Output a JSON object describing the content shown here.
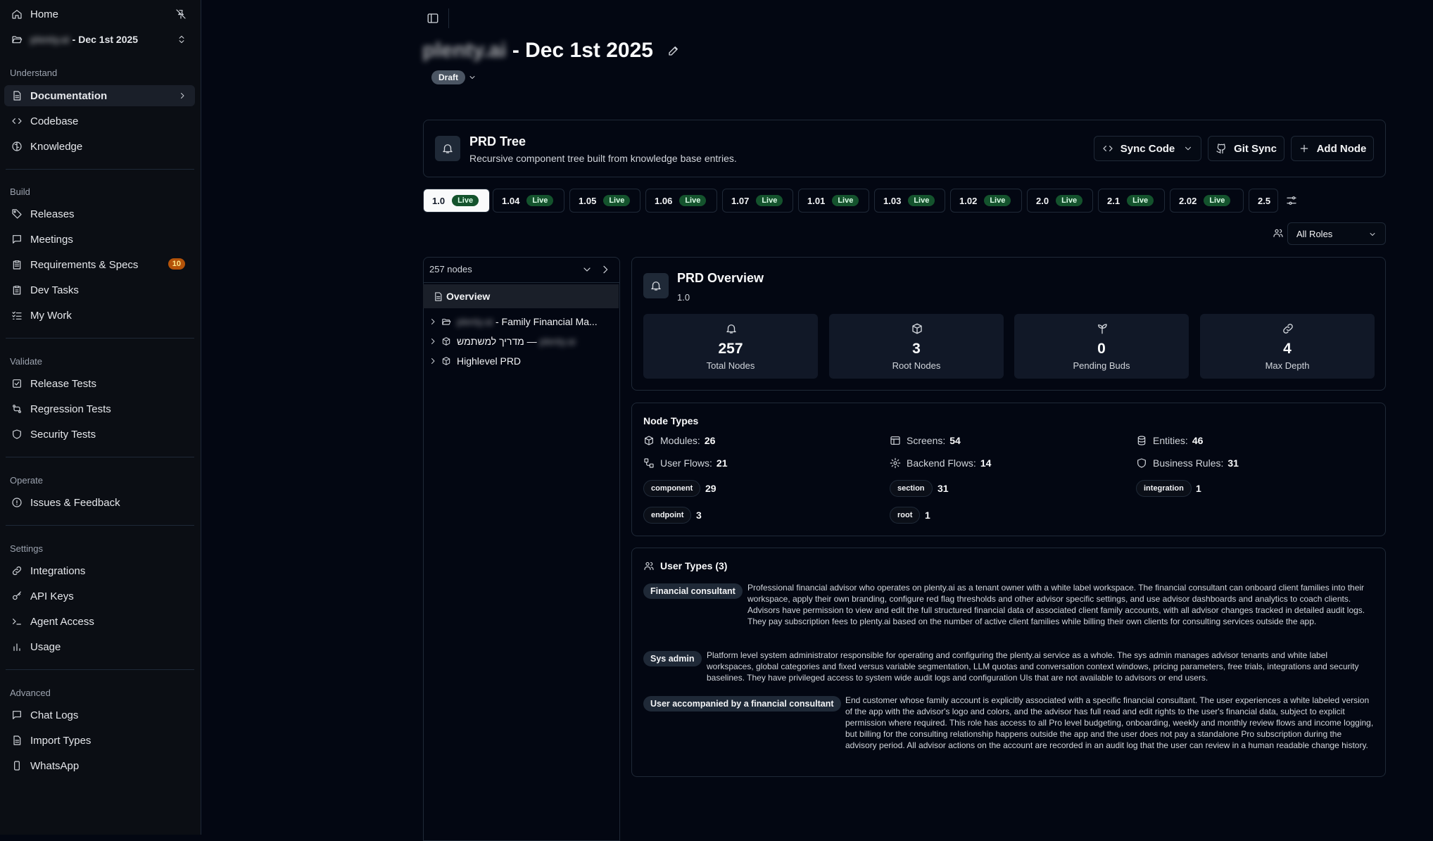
{
  "sidebar": {
    "home": "Home",
    "project": {
      "name": "plenty.ai",
      "date": " - Dec 1st 2025"
    },
    "sections": {
      "understand": "Understand",
      "build": "Build",
      "validate": "Validate",
      "operate": "Operate",
      "settings": "Settings",
      "advanced": "Advanced"
    },
    "items": {
      "documentation": "Documentation",
      "codebase": "Codebase",
      "knowledge": "Knowledge",
      "releases": "Releases",
      "meetings": "Meetings",
      "requirements": "Requirements & Specs",
      "requirements_count": "10",
      "dev_tasks": "Dev Tasks",
      "my_work": "My Work",
      "release_tests": "Release Tests",
      "regression_tests": "Regression Tests",
      "security_tests": "Security Tests",
      "issues": "Issues & Feedback",
      "integrations": "Integrations",
      "api_keys": "API Keys",
      "agent_access": "Agent Access",
      "usage": "Usage",
      "chat_logs": "Chat Logs",
      "import_types": "Import Types",
      "whatsapp": "WhatsApp"
    }
  },
  "header": {
    "title_blurred": "plenty.ai",
    "title": " - Dec 1st 2025",
    "status": "Draft"
  },
  "prd_tree": {
    "title": "PRD Tree",
    "subtitle": "Recursive component tree built from knowledge base entries.",
    "sync_code": "Sync Code",
    "git_sync": "Git Sync",
    "add_node": "Add Node"
  },
  "versions": [
    {
      "v": "1.0",
      "status": "Live"
    },
    {
      "v": "1.04",
      "status": "Live"
    },
    {
      "v": "1.05",
      "status": "Live"
    },
    {
      "v": "1.06",
      "status": "Live"
    },
    {
      "v": "1.07",
      "status": "Live"
    },
    {
      "v": "1.01",
      "status": "Live"
    },
    {
      "v": "1.03",
      "status": "Live"
    },
    {
      "v": "1.02",
      "status": "Live"
    },
    {
      "v": "2.0",
      "status": "Live"
    },
    {
      "v": "2.1",
      "status": "Live"
    },
    {
      "v": "2.02",
      "status": "Live"
    },
    {
      "v": "2.5",
      "status": ""
    }
  ],
  "roles_filter": "All Roles",
  "tree": {
    "count": "257 nodes",
    "overview": "Overview",
    "rows": [
      {
        "blur": "plenty.ai",
        "label": " - Family Financial Ma..."
      },
      {
        "label": "מדריך למשתמש — ",
        "blur": "plenty.ai"
      },
      {
        "label": "Highlevel PRD"
      }
    ]
  },
  "overview": {
    "title": "PRD Overview",
    "version": "1.0",
    "stats": [
      {
        "value": "257",
        "label": "Total Nodes",
        "icon": "bell-icon"
      },
      {
        "value": "3",
        "label": "Root Nodes",
        "icon": "box-icon"
      },
      {
        "value": "0",
        "label": "Pending Buds",
        "icon": "sprout-icon"
      },
      {
        "value": "4",
        "label": "Max Depth",
        "icon": "link-icon"
      }
    ]
  },
  "node_types": {
    "title": "Node Types",
    "modules": {
      "label": "Modules:",
      "value": "26"
    },
    "screens": {
      "label": "Screens:",
      "value": "54"
    },
    "entities": {
      "label": "Entities:",
      "value": "46"
    },
    "user_flows": {
      "label": "User Flows:",
      "value": "21"
    },
    "backend_flows": {
      "label": "Backend Flows:",
      "value": "14"
    },
    "business_rules": {
      "label": "Business Rules:",
      "value": "31"
    },
    "tags": [
      {
        "label": "component",
        "value": "29"
      },
      {
        "label": "section",
        "value": "31"
      },
      {
        "label": "integration",
        "value": "1"
      },
      {
        "label": "endpoint",
        "value": "3"
      },
      {
        "label": "root",
        "value": "1"
      }
    ]
  },
  "user_types": {
    "title": "User Types (3)",
    "items": [
      {
        "name": "Financial consultant",
        "desc": "Professional financial advisor who operates on plenty.ai as a tenant owner with a white label workspace. The financial consultant can onboard client families into their workspace, apply their own branding, configure red flag thresholds and other advisor specific settings, and use advisor dashboards and analytics to coach clients. Advisors have permission to view and edit the full structured financial data of associated client family accounts, with all advisor changes tracked in detailed audit logs. They pay subscription fees to plenty.ai based on the number of active client families while billing their own clients for consulting services outside the app."
      },
      {
        "name": "Sys admin",
        "desc": "Platform level system administrator responsible for operating and configuring the plenty.ai service as a whole. The sys admin manages advisor tenants and white label workspaces, global categories and fixed versus variable segmentation, LLM quotas and conversation context windows, pricing parameters, free trials, integrations and security baselines. They have privileged access to system wide audit logs and configuration UIs that are not available to advisors or end users."
      },
      {
        "name": "User accompanied by a financial consultant",
        "desc": "End customer whose family account is explicitly associated with a specific financial consultant. The user experiences a white labeled version of the app with the advisor's logo and colors, and the advisor has full read and edit rights to the user's financial data, subject to explicit permission where required. This role has access to all Pro level budgeting, onboarding, weekly and monthly review flows and income logging, but billing for the consulting relationship happens outside the app and the user does not pay a standalone Pro subscription during the advisory period. All advisor actions on the account are recorded in an audit log that the user can review in a human readable change history."
      }
    ]
  },
  "colors": {
    "live": "#14532d",
    "badge": "#b45309",
    "bg": "#030712"
  }
}
